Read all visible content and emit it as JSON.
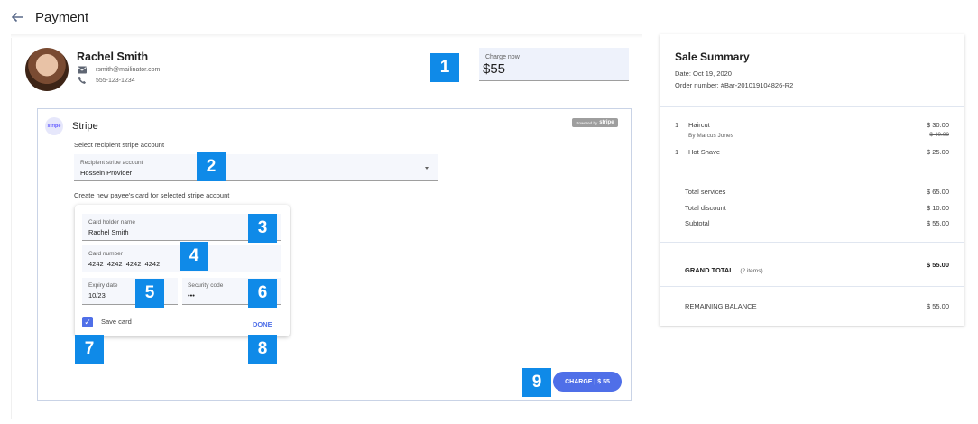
{
  "header": {
    "title": "Payment"
  },
  "customer": {
    "name": "Rachel Smith",
    "email": "rsmith@mailinator.com",
    "phone": "555-123-1234"
  },
  "charge_now": {
    "label": "Charge now",
    "currency": "$",
    "amount": "55"
  },
  "stripe": {
    "logo_text": "stripe",
    "title": "Stripe",
    "powered_by": "Powered by",
    "powered_brand": "stripe",
    "select_instruction": "Select recipient stripe account",
    "account_field": {
      "label": "Recipient stripe account",
      "value": "Hossein Provider"
    },
    "create_instruction": "Create new payee's card for selected stripe account",
    "card": {
      "holder_label": "Card holder name",
      "holder_value": "Rachel Smith",
      "number_label": "Card number",
      "number_value": "4242  4242  4242  4242",
      "expiry_label": "Expiry date",
      "expiry_value": "10/23",
      "cvc_label": "Security code",
      "cvc_value": "•••",
      "save_label": "Save card",
      "save_checked": true,
      "done_label": "DONE"
    },
    "charge_button": "CHARGE | $ 55"
  },
  "badges": [
    "1",
    "2",
    "3",
    "4",
    "5",
    "6",
    "7",
    "8",
    "9"
  ],
  "summary": {
    "title": "Sale Summary",
    "date": "Date: Oct 19, 2020",
    "order": "Order number: #Bar-201019104826-R2",
    "items": [
      {
        "qty": "1",
        "name": "Haircut",
        "staff": "By Marcus Jones",
        "price": "$ 30.00",
        "original_price": "$ 40.00"
      },
      {
        "qty": "1",
        "name": "Hot Shave",
        "price": "$ 25.00"
      }
    ],
    "totals": [
      {
        "label": "Total services",
        "value": "$ 65.00"
      },
      {
        "label": "Total discount",
        "value": "$ 10.00"
      },
      {
        "label": "Subtotal",
        "value": "$ 55.00"
      }
    ],
    "grand_total": {
      "label": "GRAND TOTAL",
      "items": "(2 items)",
      "value": "$ 55.00"
    },
    "remaining": {
      "label": "REMAINING BALANCE",
      "value": "$ 55.00"
    }
  },
  "colors": {
    "accent": "#4f6fe8",
    "badge": "#0f8ae8"
  }
}
